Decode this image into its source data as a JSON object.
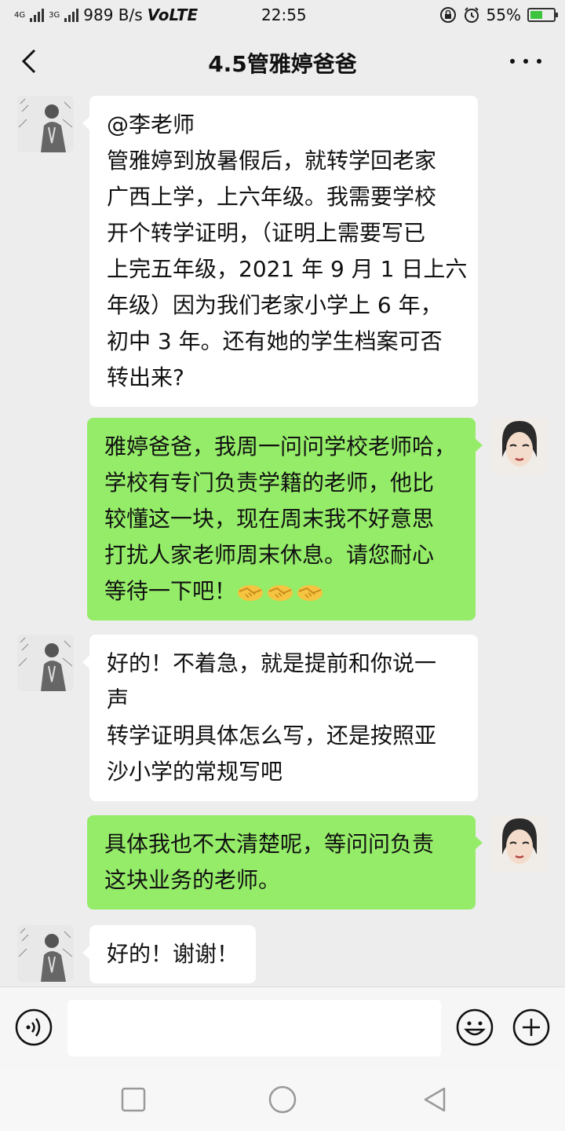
{
  "status_bar": {
    "network_left": "4G",
    "network_right": "3G",
    "speed": "989 B/s",
    "volte": "VoLTE",
    "time": "22:55",
    "battery_percent": "55%",
    "battery_level": 0.55,
    "battery_color": "#3ec33e"
  },
  "header": {
    "title": "4.5管雅婷爸爸",
    "back_icon": "chevron-left-icon",
    "more_icon": "more-dots-icon"
  },
  "messages": [
    {
      "sender": "other",
      "lines": [
        "@李老师",
        "管雅婷到放暑假后，就转学回老家",
        "广西上学，上六年级。我需要学校",
        "开个转学证明，（证明上需要写已",
        "上完五年级，2021 年 9 月 1 日上六",
        "年级）因为我们老家小学上 6 年，",
        "初中 3 年。还有她的学生档案可否",
        "转出来?"
      ]
    },
    {
      "sender": "me",
      "lines": [
        "雅婷爸爸，我周一问问学校老师哈，",
        "学校有专门负责学籍的老师，他比",
        "较懂这一块，现在周末我不好意思",
        "打扰人家老师周末休息。请您耐心",
        "等待一下吧！"
      ],
      "trailing_emoji": "handshake-icon",
      "trailing_emoji_count": 3
    },
    {
      "sender": "other",
      "lines": [
        "好的！不着急，就是提前和你说一",
        "声",
        "转学证明具体怎么写，还是按照亚",
        "沙小学的常规写吧"
      ]
    },
    {
      "sender": "me",
      "lines": [
        "具体我也不太清楚呢，等问问负责",
        "这块业务的老师。"
      ]
    },
    {
      "sender": "other",
      "lines": [
        "好的！谢谢！"
      ]
    }
  ],
  "input_bar": {
    "voice_icon": "voice-icon",
    "input_value": "",
    "emoji_icon": "emoji-icon",
    "plus_icon": "plus-icon"
  },
  "colors": {
    "background": "#ededed",
    "incoming_bubble": "#ffffff",
    "outgoing_bubble": "#95ec69"
  },
  "system_nav": {
    "recents_icon": "square-icon",
    "home_icon": "circle-icon",
    "back_icon": "triangle-back-icon"
  }
}
